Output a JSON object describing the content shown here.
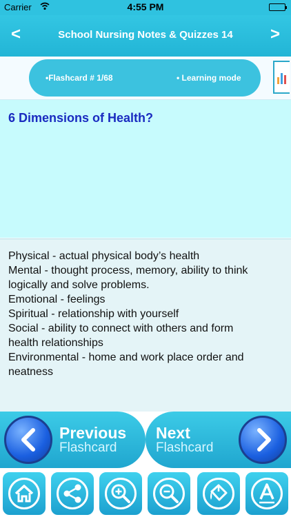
{
  "status": {
    "carrier": "Carrier",
    "time": "4:55 PM"
  },
  "nav": {
    "title": "School Nursing Notes & Quizzes 14",
    "back_glyph": "<",
    "forward_glyph": ">"
  },
  "info": {
    "card_label": "•Flashcard #  1/68",
    "mode_label": "• Learning mode"
  },
  "question": "6 Dimensions of Health?",
  "answer_lines": [
    "Physical - actual physical body’s health",
    "Mental - thought process, memory, ability to think",
    "logically and solve problems.",
    "Emotional - feelings",
    "Spiritual - relationship with yourself",
    "Social - ability to connect with others and form",
    "health relationships",
    "Environmental - home and work place order and",
    "neatness"
  ],
  "buttons": {
    "prev_top": "Previous",
    "prev_bottom": "Flashcard",
    "next_top": "Next",
    "next_bottom": "Flashcard"
  },
  "toolbar_icons": [
    "home-icon",
    "share-icon",
    "zoom-in-icon",
    "zoom-out-icon",
    "paint-bucket-icon",
    "font-icon"
  ],
  "colors": {
    "accent": "#2fc2e0",
    "question_bg": "#c7fbfd",
    "question_text": "#1a2bc0",
    "answer_bg": "#e4f4f7"
  }
}
